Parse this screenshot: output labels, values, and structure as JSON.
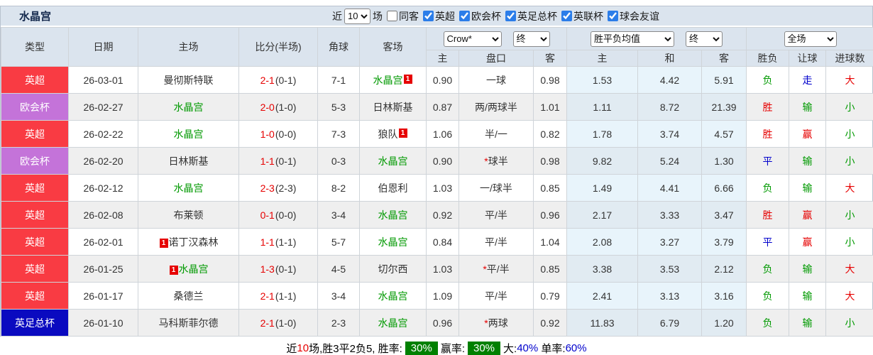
{
  "colors": {
    "red": "#f93b43",
    "purple": "#c473d9",
    "blue": "#0a0ac0",
    "text_red": "#e60000",
    "text_green": "#009900",
    "text_blue": "#0000cc",
    "green_box": "#008000",
    "header_bg": "#dbe4ee",
    "row_alt": "#efefef",
    "avg_col": "#e8f4fb"
  },
  "titlebar": {
    "title": "水晶宫",
    "near_label": "近",
    "match_count": "10",
    "games_label": "场",
    "checkboxes": [
      {
        "label": "同客",
        "checked": false
      },
      {
        "label": "英超",
        "checked": true
      },
      {
        "label": "欧会杯",
        "checked": true
      },
      {
        "label": "英足总杯",
        "checked": true
      },
      {
        "label": "英联杯",
        "checked": true
      },
      {
        "label": "球会友谊",
        "checked": true
      }
    ]
  },
  "table": {
    "left_columns": [
      "类型",
      "日期",
      "主场",
      "比分(半场)",
      "角球",
      "客场"
    ],
    "selects": {
      "odds_company": "Crow*",
      "odds_state": "终",
      "avg_label": "胜平负均值",
      "avg_state": "终",
      "scope": "全场"
    },
    "sub_columns": [
      "主",
      "盘口",
      "客",
      "主",
      "和",
      "客",
      "胜负",
      "让球",
      "进球数"
    ],
    "rows": [
      {
        "league": "英超",
        "league_color": "red",
        "date": "26-03-01",
        "home": "曼彻斯特联",
        "home_green": false,
        "home_badge": "",
        "home_badge_pos": "",
        "away": "水晶宫",
        "away_green": true,
        "away_badge": "1",
        "away_badge_pos": "after",
        "score": "2-1",
        "half": "(0-1)",
        "corner": "7-1",
        "odds_home": "0.90",
        "handicap": "一球",
        "handicap_star": false,
        "odds_away": "0.98",
        "avg_home": "1.53",
        "avg_draw": "4.42",
        "avg_away": "5.91",
        "spf": "负",
        "spf_color": "green",
        "rq": "走",
        "rq_color": "blue",
        "jq": "大",
        "jq_color": "red"
      },
      {
        "league": "欧会杯",
        "league_color": "purple",
        "date": "26-02-27",
        "home": "水晶宫",
        "home_green": true,
        "home_badge": "",
        "home_badge_pos": "",
        "away": "日林斯基",
        "away_green": false,
        "away_badge": "",
        "away_badge_pos": "",
        "score": "2-0",
        "half": "(1-0)",
        "corner": "5-3",
        "odds_home": "0.87",
        "handicap": "两/两球半",
        "handicap_star": false,
        "odds_away": "1.01",
        "avg_home": "1.11",
        "avg_draw": "8.72",
        "avg_away": "21.39",
        "spf": "胜",
        "spf_color": "red",
        "rq": "输",
        "rq_color": "green",
        "jq": "小",
        "jq_color": "green"
      },
      {
        "league": "英超",
        "league_color": "red",
        "date": "26-02-22",
        "home": "水晶宫",
        "home_green": true,
        "home_badge": "",
        "home_badge_pos": "",
        "away": "狼队",
        "away_green": false,
        "away_badge": "1",
        "away_badge_pos": "after",
        "score": "1-0",
        "half": "(0-0)",
        "corner": "7-3",
        "odds_home": "1.06",
        "handicap": "半/一",
        "handicap_star": false,
        "odds_away": "0.82",
        "avg_home": "1.78",
        "avg_draw": "3.74",
        "avg_away": "4.57",
        "spf": "胜",
        "spf_color": "red",
        "rq": "赢",
        "rq_color": "red",
        "jq": "小",
        "jq_color": "green"
      },
      {
        "league": "欧会杯",
        "league_color": "purple",
        "date": "26-02-20",
        "home": "日林斯基",
        "home_green": false,
        "home_badge": "",
        "home_badge_pos": "",
        "away": "水晶宫",
        "away_green": true,
        "away_badge": "",
        "away_badge_pos": "",
        "score": "1-1",
        "half": "(0-1)",
        "corner": "0-3",
        "odds_home": "0.90",
        "handicap": "球半",
        "handicap_star": true,
        "odds_away": "0.98",
        "avg_home": "9.82",
        "avg_draw": "5.24",
        "avg_away": "1.30",
        "spf": "平",
        "spf_color": "blue",
        "rq": "输",
        "rq_color": "green",
        "jq": "小",
        "jq_color": "green"
      },
      {
        "league": "英超",
        "league_color": "red",
        "date": "26-02-12",
        "home": "水晶宫",
        "home_green": true,
        "home_badge": "",
        "home_badge_pos": "",
        "away": "伯恩利",
        "away_green": false,
        "away_badge": "",
        "away_badge_pos": "",
        "score": "2-3",
        "half": "(2-3)",
        "corner": "8-2",
        "odds_home": "1.03",
        "handicap": "一/球半",
        "handicap_star": false,
        "odds_away": "0.85",
        "avg_home": "1.49",
        "avg_draw": "4.41",
        "avg_away": "6.66",
        "spf": "负",
        "spf_color": "green",
        "rq": "输",
        "rq_color": "green",
        "jq": "大",
        "jq_color": "red"
      },
      {
        "league": "英超",
        "league_color": "red",
        "date": "26-02-08",
        "home": "布莱顿",
        "home_green": false,
        "home_badge": "",
        "home_badge_pos": "",
        "away": "水晶宫",
        "away_green": true,
        "away_badge": "",
        "away_badge_pos": "",
        "score": "0-1",
        "half": "(0-0)",
        "corner": "3-4",
        "odds_home": "0.92",
        "handicap": "平/半",
        "handicap_star": false,
        "odds_away": "0.96",
        "avg_home": "2.17",
        "avg_draw": "3.33",
        "avg_away": "3.47",
        "spf": "胜",
        "spf_color": "red",
        "rq": "赢",
        "rq_color": "red",
        "jq": "小",
        "jq_color": "green"
      },
      {
        "league": "英超",
        "league_color": "red",
        "date": "26-02-01",
        "home": "诺丁汉森林",
        "home_green": false,
        "home_badge": "1",
        "home_badge_pos": "before",
        "away": "水晶宫",
        "away_green": true,
        "away_badge": "",
        "away_badge_pos": "",
        "score": "1-1",
        "half": "(1-1)",
        "corner": "5-7",
        "odds_home": "0.84",
        "handicap": "平/半",
        "handicap_star": false,
        "odds_away": "1.04",
        "avg_home": "2.08",
        "avg_draw": "3.27",
        "avg_away": "3.79",
        "spf": "平",
        "spf_color": "blue",
        "rq": "赢",
        "rq_color": "red",
        "jq": "小",
        "jq_color": "green"
      },
      {
        "league": "英超",
        "league_color": "red",
        "date": "26-01-25",
        "home": "水晶宫",
        "home_green": true,
        "home_badge": "1",
        "home_badge_pos": "before",
        "away": "切尔西",
        "away_green": false,
        "away_badge": "",
        "away_badge_pos": "",
        "score": "1-3",
        "half": "(0-1)",
        "corner": "4-5",
        "odds_home": "1.03",
        "handicap": "平/半",
        "handicap_star": true,
        "odds_away": "0.85",
        "avg_home": "3.38",
        "avg_draw": "3.53",
        "avg_away": "2.12",
        "spf": "负",
        "spf_color": "green",
        "rq": "输",
        "rq_color": "green",
        "jq": "大",
        "jq_color": "red"
      },
      {
        "league": "英超",
        "league_color": "red",
        "date": "26-01-17",
        "home": "桑德兰",
        "home_green": false,
        "home_badge": "",
        "home_badge_pos": "",
        "away": "水晶宫",
        "away_green": true,
        "away_badge": "",
        "away_badge_pos": "",
        "score": "2-1",
        "half": "(1-1)",
        "corner": "3-4",
        "odds_home": "1.09",
        "handicap": "平/半",
        "handicap_star": false,
        "odds_away": "0.79",
        "avg_home": "2.41",
        "avg_draw": "3.13",
        "avg_away": "3.16",
        "spf": "负",
        "spf_color": "green",
        "rq": "输",
        "rq_color": "green",
        "jq": "大",
        "jq_color": "red"
      },
      {
        "league": "英足总杯",
        "league_color": "blue",
        "date": "26-01-10",
        "home": "马科斯菲尔德",
        "home_green": false,
        "home_badge": "",
        "home_badge_pos": "",
        "away": "水晶宫",
        "away_green": true,
        "away_badge": "",
        "away_badge_pos": "",
        "score": "2-1",
        "half": "(1-0)",
        "corner": "2-3",
        "odds_home": "0.96",
        "handicap": "两球",
        "handicap_star": true,
        "odds_away": "0.92",
        "avg_home": "11.83",
        "avg_draw": "6.79",
        "avg_away": "1.20",
        "spf": "负",
        "spf_color": "green",
        "rq": "输",
        "rq_color": "green",
        "jq": "小",
        "jq_color": "green"
      }
    ]
  },
  "summary": {
    "segments": [
      {
        "t": "近",
        "s": "p"
      },
      {
        "t": "10",
        "s": "r"
      },
      {
        "t": "场,胜3平2负5, 胜率:",
        "s": "p"
      },
      {
        "t": "30%",
        "s": "g"
      },
      {
        "t": "赢率:",
        "s": "p"
      },
      {
        "t": "30%",
        "s": "g"
      },
      {
        "t": "大:",
        "s": "p"
      },
      {
        "t": "40%",
        "s": "b"
      },
      {
        "t": " 单率:",
        "s": "p"
      },
      {
        "t": "60%",
        "s": "b"
      }
    ]
  }
}
